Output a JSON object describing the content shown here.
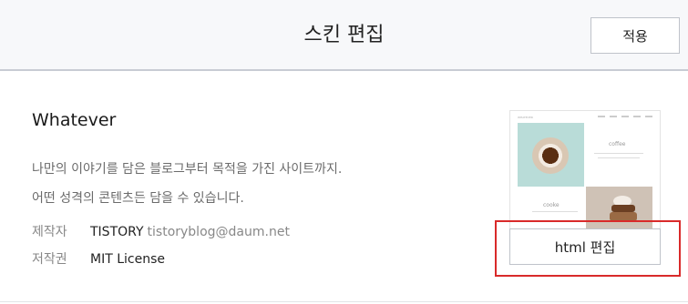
{
  "header": {
    "title": "스킨 편집",
    "apply_label": "적용"
  },
  "skin": {
    "name": "Whatever",
    "description_lines": [
      "나만의 이야기를 담은 블로그부터 목적을 가진 사이트까지.",
      "어떤 성격의 콘텐츠든 담을 수 있습니다."
    ],
    "author_label": "제작자",
    "author_name": "TISTORY",
    "author_email": "tistoryblog@daum.net",
    "license_label": "저작권",
    "license_value": "MIT License"
  },
  "preview": {
    "brand": "WHATEVER",
    "coffee_label": "coffee",
    "cooke_label": "cooke"
  },
  "actions": {
    "html_edit_label": "html 편집"
  },
  "colors": {
    "highlight": "#d92a2a",
    "header_bg": "#f7f8fa"
  }
}
